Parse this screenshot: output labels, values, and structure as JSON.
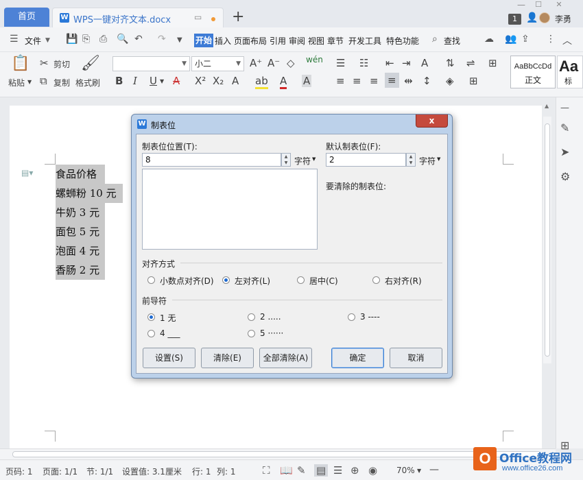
{
  "tabs": {
    "home": "首页",
    "doc": "WPS一键对齐文本.docx"
  },
  "titlebar": {
    "badge": "1",
    "user": "李勇"
  },
  "menu": {
    "file": "文件",
    "items": [
      "开始",
      "插入",
      "页面布局",
      "引用",
      "审阅",
      "视图",
      "章节",
      "开发工具",
      "特色功能"
    ],
    "search": "查找"
  },
  "ribbon": {
    "paste": "粘贴",
    "cut": "剪切",
    "copy": "复制",
    "format_painter": "格式刷",
    "font_name": "",
    "font_size": "小二",
    "style_sample": "AaBbCcDd",
    "style_name": "正文",
    "style2_sample": "Aa",
    "style2_name": "标"
  },
  "document": {
    "lines": [
      "食品价格",
      "螺蛳粉 10 元",
      "牛奶 3 元",
      "面包 5 元",
      "泡面 4 元",
      "香肠 2 元"
    ]
  },
  "dialog": {
    "title": "制表位",
    "close": "x",
    "tab_pos_label": "制表位位置(T):",
    "tab_pos_value": "8",
    "unit": "字符",
    "default_label": "默认制表位(F):",
    "default_value": "2",
    "clear_label": "要清除的制表位:",
    "align_group": "对齐方式",
    "align_options": [
      "小数点对齐(D)",
      "左对齐(L)",
      "居中(C)",
      "右对齐(R)"
    ],
    "align_selected": 1,
    "leader_group": "前导符",
    "leader_options": [
      "1 无",
      "2 .....",
      "3 ----",
      "4 ___",
      "5 ······"
    ],
    "leader_selected": 0,
    "buttons": {
      "set": "设置(S)",
      "clear": "清除(E)",
      "clear_all": "全部清除(A)",
      "ok": "确定",
      "cancel": "取消"
    }
  },
  "statusbar": {
    "page_num": "页码: 1",
    "page": "页面: 1/1",
    "section": "节: 1/1",
    "setting": "设置值: 3.1厘米",
    "row": "行: 1",
    "col": "列: 1",
    "zoom": "70%"
  },
  "watermark": {
    "brand": "Office教程网",
    "url": "www.office26.com"
  }
}
